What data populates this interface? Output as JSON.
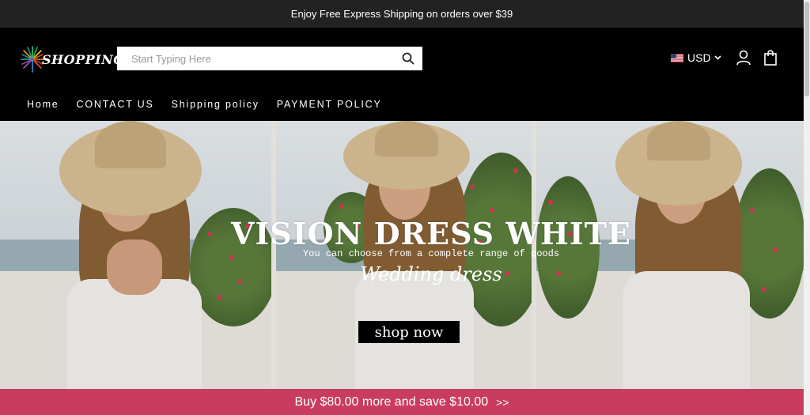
{
  "announcement": "Enjoy Free Express Shipping on orders over $39",
  "brand": {
    "logo_text": "SHOPPING"
  },
  "search": {
    "placeholder": "Start Typing Here"
  },
  "currency": {
    "code": "USD"
  },
  "nav": {
    "items": [
      {
        "label": "Home"
      },
      {
        "label": "CONTACT US"
      },
      {
        "label": "Shipping policy"
      },
      {
        "label": "PAYMENT POLICY"
      }
    ]
  },
  "hero": {
    "title": "VISION DRESS WHITE",
    "subtitle": "You can choose from a complete range of goods",
    "script_text": "Wedding dress",
    "button_label": "shop now"
  },
  "promo": {
    "text": "Buy $80.00 more and save $10.00",
    "arrows": ">>"
  },
  "colors": {
    "announcement_bg": "#222222",
    "header_bg": "#000000",
    "promo_bg": "#c93c5f",
    "button_bg": "#000000"
  },
  "icons": [
    "search-icon",
    "us-flag-icon",
    "chevron-down-icon",
    "account-icon",
    "cart-icon"
  ]
}
